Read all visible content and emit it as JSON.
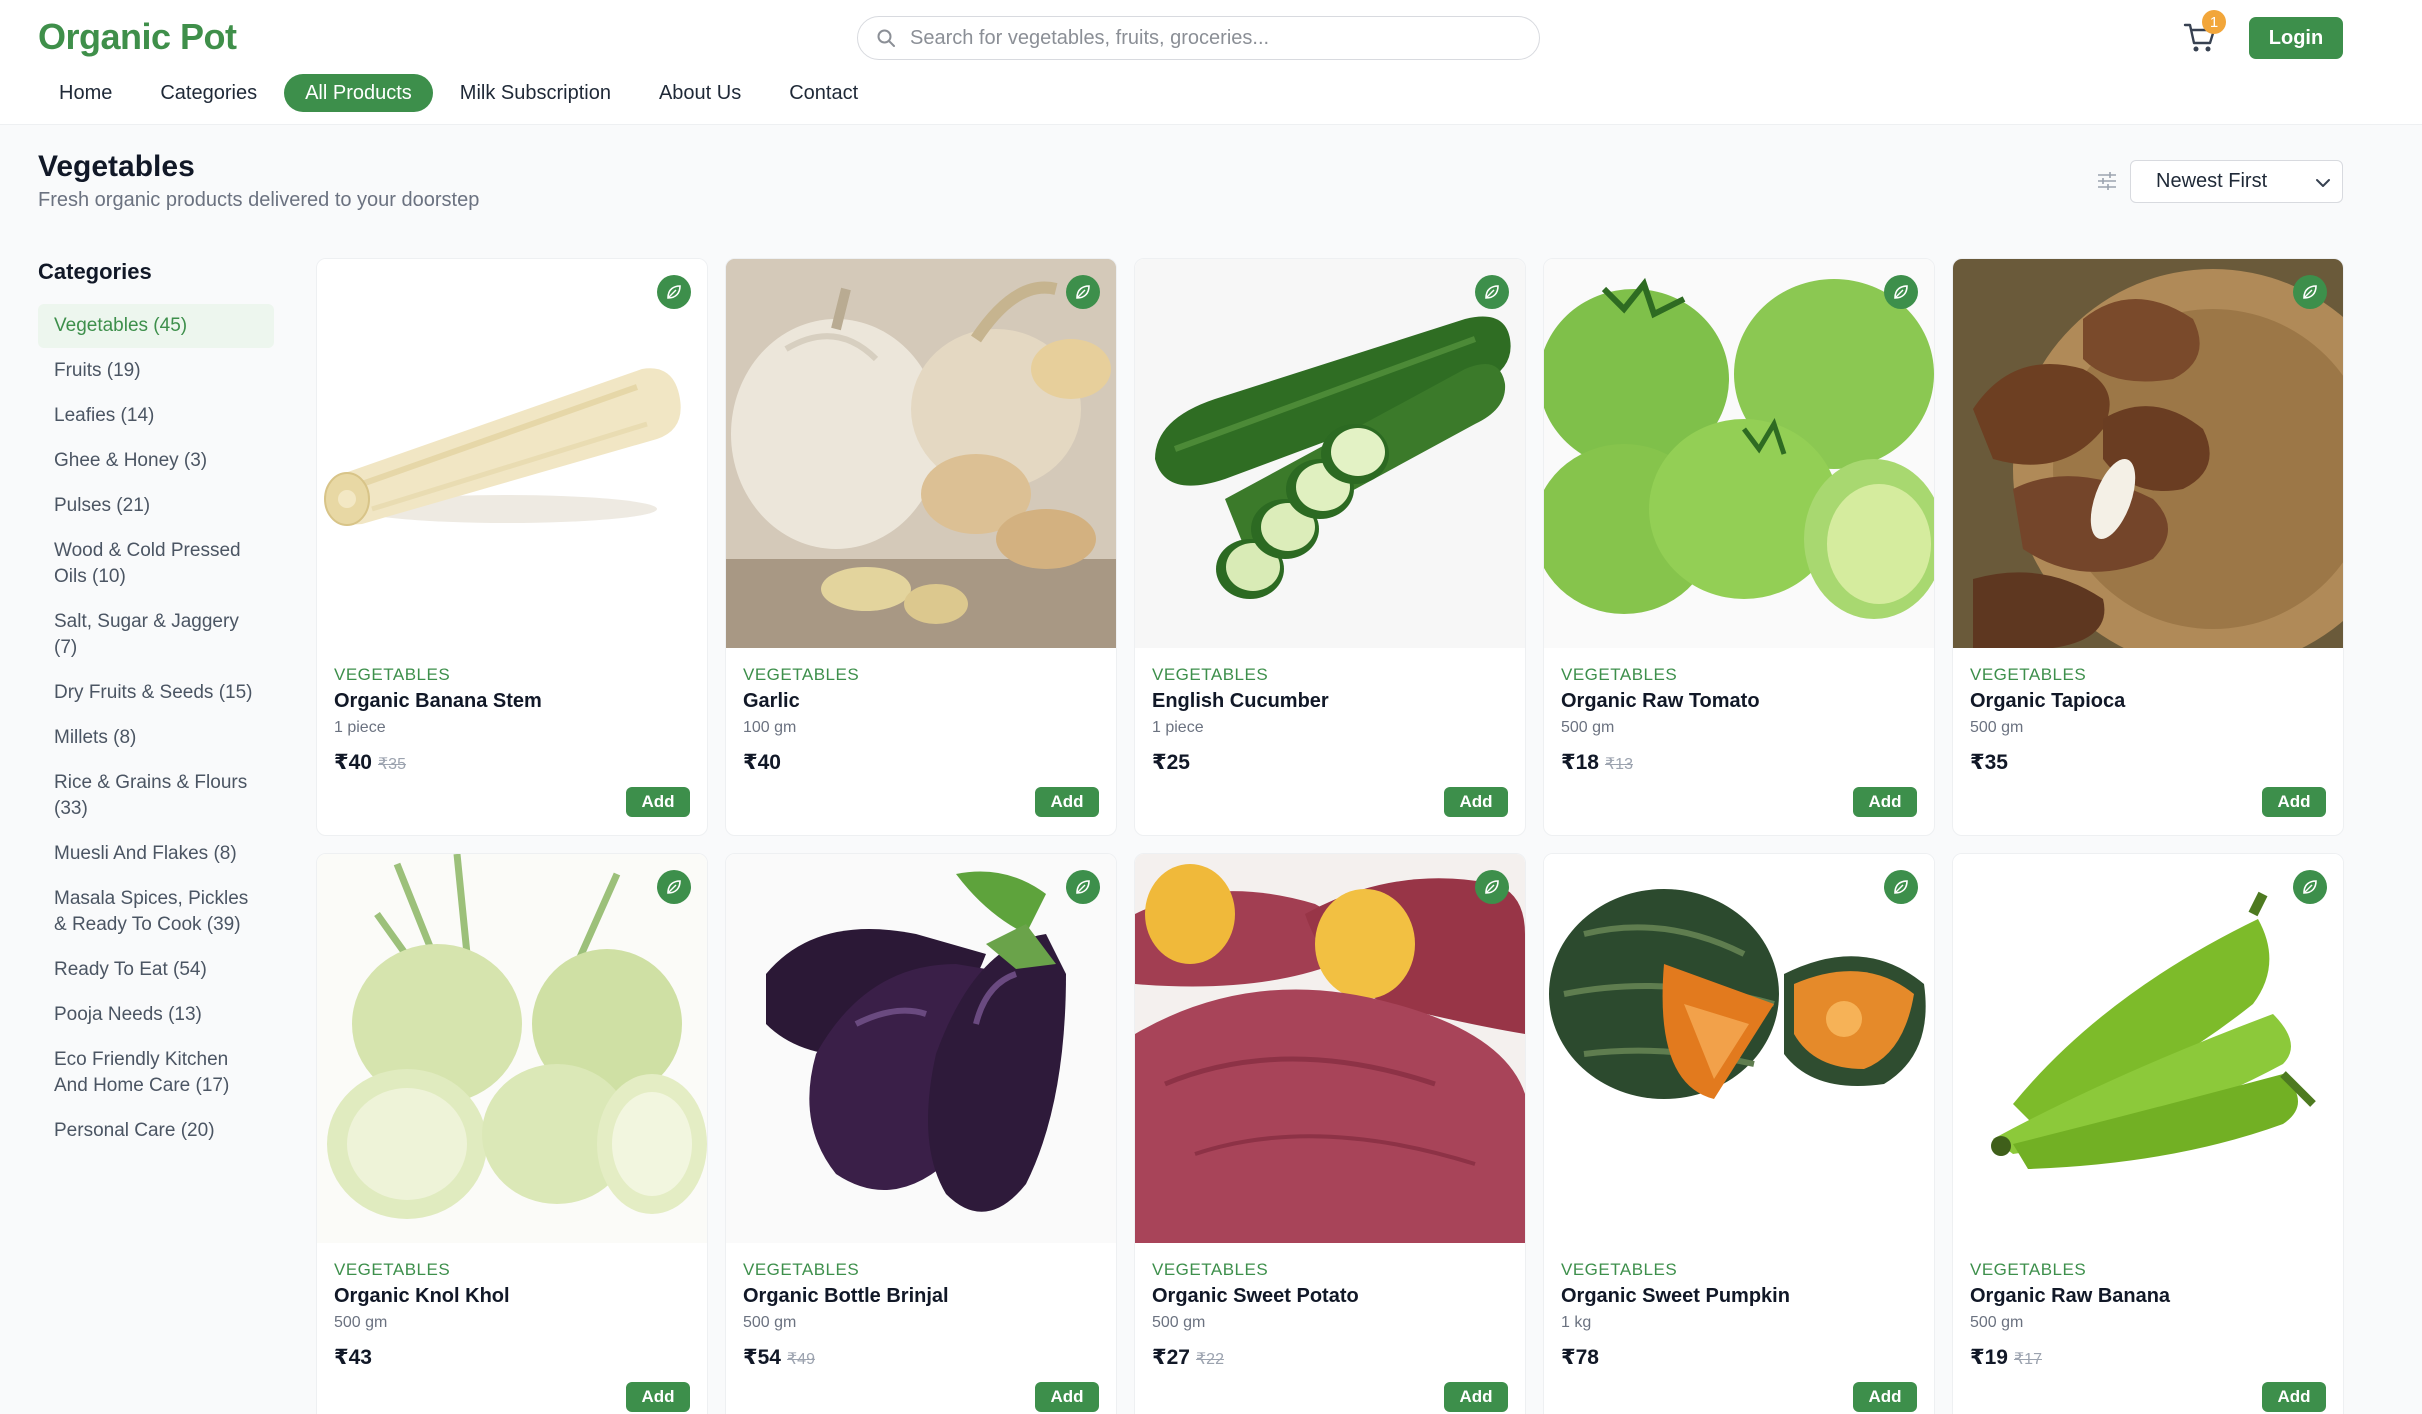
{
  "header": {
    "logo": "Organic Pot",
    "search_placeholder": "Search for vegetables, fruits, groceries...",
    "cart_count": "1",
    "login_label": "Login"
  },
  "nav": {
    "items": [
      {
        "label": "Home"
      },
      {
        "label": "Categories"
      },
      {
        "label": "All Products",
        "active": true
      },
      {
        "label": "Milk Subscription"
      },
      {
        "label": "About Us"
      },
      {
        "label": "Contact"
      }
    ]
  },
  "page": {
    "title": "Vegetables",
    "subtitle": "Fresh organic products delivered to your doorstep",
    "sort_value": "Newest First"
  },
  "sidebar": {
    "title": "Categories",
    "items": [
      {
        "label": "Vegetables (45)",
        "active": true
      },
      {
        "label": "Fruits (19)"
      },
      {
        "label": "Leafies (14)"
      },
      {
        "label": "Ghee & Honey (3)"
      },
      {
        "label": "Pulses (21)"
      },
      {
        "label": "Wood & Cold Pressed Oils (10)"
      },
      {
        "label": "Salt, Sugar & Jaggery (7)"
      },
      {
        "label": "Dry Fruits & Seeds (15)"
      },
      {
        "label": "Millets (8)"
      },
      {
        "label": "Rice & Grains & Flours (33)"
      },
      {
        "label": "Muesli And Flakes (8)"
      },
      {
        "label": "Masala Spices, Pickles & Ready To Cook (39)"
      },
      {
        "label": "Ready To Eat (54)"
      },
      {
        "label": "Pooja Needs (13)"
      },
      {
        "label": "Eco Friendly Kitchen And Home Care (17)"
      },
      {
        "label": "Personal Care (20)"
      }
    ]
  },
  "products": [
    {
      "category": "VEGETABLES",
      "name": "Organic Banana Stem",
      "qty": "1 piece",
      "price": "₹40",
      "mrp": "₹35",
      "add": "Add",
      "image": "banana-stem"
    },
    {
      "category": "VEGETABLES",
      "name": "Garlic",
      "qty": "100 gm",
      "price": "₹40",
      "mrp": "",
      "add": "Add",
      "image": "garlic"
    },
    {
      "category": "VEGETABLES",
      "name": "English Cucumber",
      "qty": "1 piece",
      "price": "₹25",
      "mrp": "",
      "add": "Add",
      "image": "cucumber"
    },
    {
      "category": "VEGETABLES",
      "name": "Organic Raw Tomato",
      "qty": "500 gm",
      "price": "₹18",
      "mrp": "₹13",
      "add": "Add",
      "image": "raw-tomato"
    },
    {
      "category": "VEGETABLES",
      "name": "Organic Tapioca",
      "qty": "500 gm",
      "price": "₹35",
      "mrp": "",
      "add": "Add",
      "image": "tapioca"
    },
    {
      "category": "VEGETABLES",
      "name": "Organic Knol Khol",
      "qty": "500 gm",
      "price": "₹43",
      "mrp": "",
      "add": "Add",
      "image": "knol-khol"
    },
    {
      "category": "VEGETABLES",
      "name": "Organic Bottle Brinjal",
      "qty": "500 gm",
      "price": "₹54",
      "mrp": "₹49",
      "add": "Add",
      "image": "brinjal"
    },
    {
      "category": "VEGETABLES",
      "name": "Organic Sweet Potato",
      "qty": "500 gm",
      "price": "₹27",
      "mrp": "₹22",
      "add": "Add",
      "image": "sweet-potato"
    },
    {
      "category": "VEGETABLES",
      "name": "Organic Sweet Pumpkin",
      "qty": "1 kg",
      "price": "₹78",
      "mrp": "",
      "add": "Add",
      "image": "pumpkin"
    },
    {
      "category": "VEGETABLES",
      "name": "Organic Raw Banana",
      "qty": "500 gm",
      "price": "₹19",
      "mrp": "₹17",
      "add": "Add",
      "image": "raw-banana"
    }
  ],
  "colors": {
    "brand": "#3d8f4b",
    "badge": "#f2a63a"
  }
}
